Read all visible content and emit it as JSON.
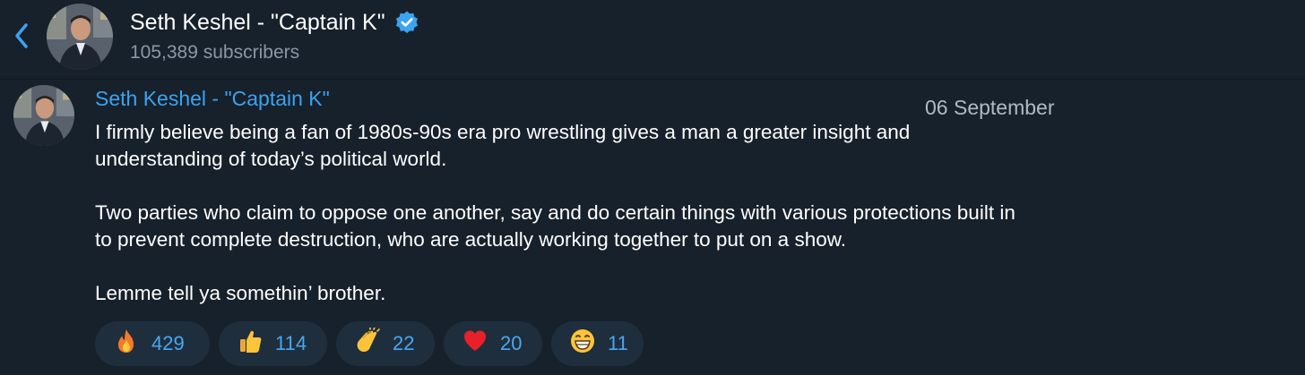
{
  "header": {
    "channel_name": "Seth Keshel - \"Captain K\"",
    "subscribers": "105,389 subscribers",
    "back_icon": "chevron-left-icon",
    "verified_icon": "verified-badge-icon"
  },
  "message": {
    "author": "Seth Keshel - \"Captain K\"",
    "date": "06 September",
    "lines": [
      "I firmly believe being a fan of 1980s-90s era pro wrestling gives a man a greater insight and",
      "understanding of today’s political world.",
      "Two parties who claim to oppose one another, say and do certain things with various protections built in",
      "to prevent complete destruction, who are actually working together to put on a show.",
      "Lemme tell ya somethin’ brother."
    ]
  },
  "reactions": [
    {
      "emoji": "🔥",
      "icon": "fire-icon",
      "count": "429"
    },
    {
      "emoji": "👍",
      "icon": "thumbs-up-icon",
      "count": "114"
    },
    {
      "emoji": "👏",
      "icon": "clapping-hands-icon",
      "count": "22"
    },
    {
      "emoji": "❤",
      "icon": "red-heart-icon",
      "count": "20"
    },
    {
      "emoji": "😁",
      "icon": "grinning-face-icon",
      "count": "11"
    }
  ],
  "colors": {
    "background": "#17212b",
    "accent": "#3ba3f0",
    "reaction_bg": "#1f2e3d",
    "muted_text": "#8b97a3"
  }
}
